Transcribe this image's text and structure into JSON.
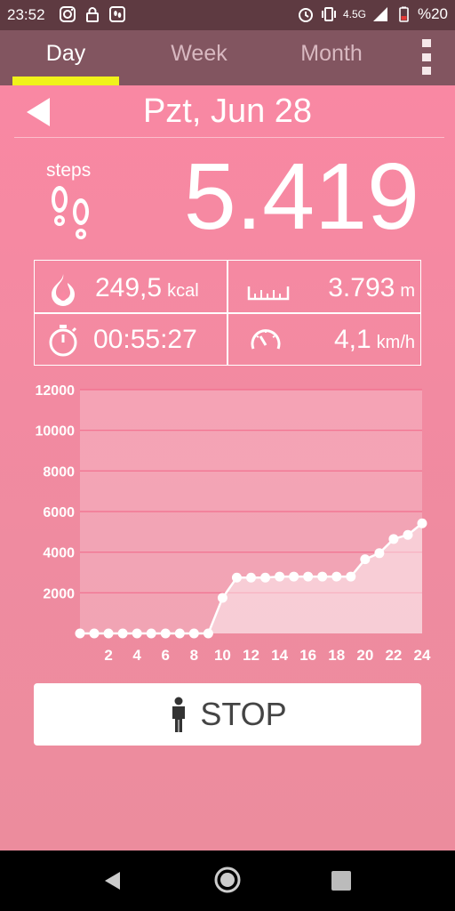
{
  "status_bar": {
    "time": "23:52",
    "network": "4.5G",
    "battery": "%20"
  },
  "tabs": [
    {
      "label": "Day",
      "active": true
    },
    {
      "label": "Week",
      "active": false
    },
    {
      "label": "Month",
      "active": false
    }
  ],
  "date": "Pzt, Jun 28",
  "steps": {
    "label": "steps",
    "value": "5.419"
  },
  "stats": {
    "calories": {
      "value": "249,5",
      "unit": "kcal"
    },
    "distance": {
      "value": "3.793",
      "unit": "m"
    },
    "duration": {
      "value": "00:55:27"
    },
    "speed": {
      "value": "4,1",
      "unit": "km/h"
    }
  },
  "stop_button": {
    "label": "STOP"
  },
  "colors": {
    "accent": "#f0f21a",
    "tabbar": "#825560",
    "statusbar": "#5e3a41",
    "background": "#f988a3"
  },
  "chart_data": {
    "type": "area",
    "x": [
      0,
      1,
      2,
      3,
      4,
      5,
      6,
      7,
      8,
      9,
      10,
      11,
      12,
      13,
      14,
      15,
      16,
      17,
      18,
      19,
      20,
      21,
      22,
      23,
      24
    ],
    "values": [
      0,
      0,
      0,
      0,
      0,
      0,
      0,
      0,
      0,
      0,
      1750,
      2750,
      2750,
      2750,
      2800,
      2800,
      2800,
      2800,
      2800,
      2800,
      3650,
      3950,
      4650,
      4850,
      5419
    ],
    "xticks": [
      "2",
      "4",
      "6",
      "8",
      "10",
      "12",
      "14",
      "16",
      "18",
      "20",
      "22",
      "24"
    ],
    "xtick_values": [
      2,
      4,
      6,
      8,
      10,
      12,
      14,
      16,
      18,
      20,
      22,
      24
    ],
    "yticks": [
      "2000",
      "4000",
      "6000",
      "8000",
      "10000",
      "12000"
    ],
    "ytick_values": [
      2000,
      4000,
      6000,
      8000,
      10000,
      12000
    ],
    "xlim": [
      0,
      24
    ],
    "ylim": [
      0,
      12000
    ],
    "grid": true
  }
}
